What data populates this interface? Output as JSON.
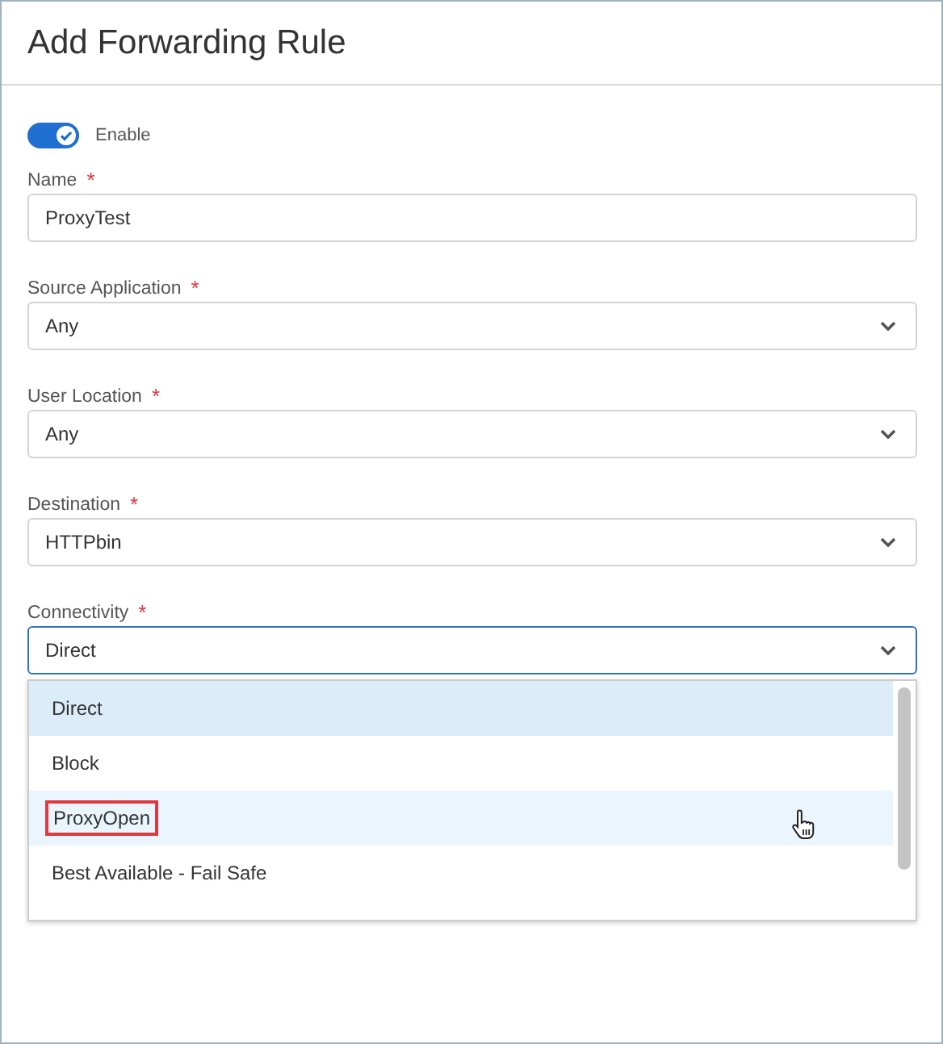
{
  "dialog": {
    "title": "Add Forwarding Rule"
  },
  "enable": {
    "label": "Enable",
    "on": true
  },
  "fields": [
    {
      "kind": "text",
      "label": "Name",
      "required_mark": "*",
      "value": "ProxyTest",
      "focused": false
    },
    {
      "kind": "select",
      "label": "Source Application",
      "required_mark": "*",
      "value": "Any",
      "focused": false
    },
    {
      "kind": "select",
      "label": "User Location",
      "required_mark": "*",
      "value": "Any",
      "focused": false
    },
    {
      "kind": "select",
      "label": "Destination",
      "required_mark": "*",
      "value": "HTTPbin",
      "focused": false
    },
    {
      "kind": "select",
      "label": "Connectivity",
      "required_mark": "*",
      "value": "Direct",
      "focused": true
    }
  ],
  "dropdown": {
    "options": [
      {
        "label": "Direct",
        "selected": true,
        "hovered": false,
        "outlined": false
      },
      {
        "label": "Block",
        "selected": false,
        "hovered": false,
        "outlined": false
      },
      {
        "label": "ProxyOpen",
        "selected": false,
        "hovered": true,
        "outlined": true
      },
      {
        "label": "Best Available - Fail Safe",
        "selected": false,
        "hovered": false,
        "outlined": false
      }
    ]
  }
}
